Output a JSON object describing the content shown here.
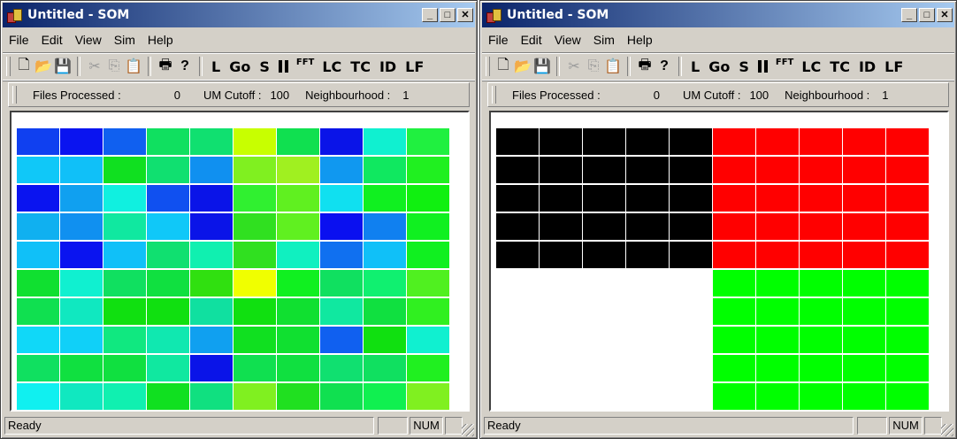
{
  "window": {
    "title": "Untitled - SOM",
    "minimize_glyph": "_",
    "maximize_glyph": "□",
    "close_glyph": "✕"
  },
  "menu": [
    "File",
    "Edit",
    "View",
    "Sim",
    "Help"
  ],
  "toolbar": {
    "icons": [
      "new-file-icon",
      "open-folder-icon",
      "save-disk-icon",
      "cut-icon",
      "copy-icon",
      "paste-icon",
      "print-icon",
      "help-icon"
    ],
    "text_buttons": [
      "L",
      "Go",
      "S",
      "FFT",
      "LC",
      "TC",
      "ID",
      "LF"
    ],
    "icon_glyphs": {
      "new": "🗋",
      "open": "📂",
      "save": "💾",
      "cut": "✂",
      "copy": "⎘",
      "paste": "📋",
      "print": "🖶",
      "help": "?"
    }
  },
  "info": {
    "files_label": "Files Processed :",
    "files_value": "0",
    "cutoff_label": "UM Cutoff :",
    "cutoff_value": "100",
    "neigh_label": "Neighbourhood :",
    "neigh_value": "1"
  },
  "status": {
    "ready": "Ready",
    "num": "NUM"
  },
  "left_map": {
    "rows": 10,
    "cols": 10,
    "colors": [
      [
        "#1040f0",
        "#0a14f0",
        "#1060f0",
        "#10e060",
        "#10e070",
        "#c8ff00",
        "#10e050",
        "#0a14e8",
        "#10f0d0",
        "#20f040"
      ],
      [
        "#10c8f8",
        "#10c0f8",
        "#10e020",
        "#10e070",
        "#1090f0",
        "#80f020",
        "#a0f020",
        "#1098f0",
        "#10e860",
        "#20f020"
      ],
      [
        "#0a14f0",
        "#10a0f0",
        "#10f0e0",
        "#1050f0",
        "#0a14e8",
        "#30f030",
        "#60f020",
        "#10e0f0",
        "#10f020",
        "#10f010"
      ],
      [
        "#10b0f0",
        "#1090f0",
        "#10e8a0",
        "#10c8f8",
        "#0a14e8",
        "#30e020",
        "#60f020",
        "#0a10f0",
        "#1080f0",
        "#10f020"
      ],
      [
        "#10c0f8",
        "#0a14f0",
        "#10c0f8",
        "#10e070",
        "#10f0b0",
        "#30e020",
        "#10f0c0",
        "#1070f0",
        "#10c0f8",
        "#10f020"
      ],
      [
        "#10e030",
        "#10f0d0",
        "#10e060",
        "#10e040",
        "#30e010",
        "#f0ff00",
        "#10f020",
        "#10e060",
        "#10f070",
        "#50f020"
      ],
      [
        "#10e050",
        "#10e8c0",
        "#10e010",
        "#10e010",
        "#10e0a0",
        "#10e010",
        "#10e030",
        "#10e8a0",
        "#10e040",
        "#30f020"
      ],
      [
        "#10d8f8",
        "#10d0f8",
        "#10e880",
        "#10e8b0",
        "#10a0f0",
        "#10e020",
        "#10e030",
        "#1060f0",
        "#10e010",
        "#10f0d0"
      ],
      [
        "#10e060",
        "#10e040",
        "#10e040",
        "#10e8a0",
        "#0a14e8",
        "#10e050",
        "#10e040",
        "#10e070",
        "#10e060",
        "#20f020"
      ],
      [
        "#10f0f0",
        "#10e8c0",
        "#10f0b0",
        "#10e020",
        "#10e080",
        "#80f020",
        "#20e020",
        "#10e050",
        "#10f050",
        "#80f020"
      ]
    ]
  },
  "right_map": {
    "rows": 10,
    "cols": 10,
    "colors": [
      [
        "#000000",
        "#000000",
        "#000000",
        "#000000",
        "#000000",
        "#ff0000",
        "#ff0000",
        "#ff0000",
        "#ff0000",
        "#ff0000"
      ],
      [
        "#000000",
        "#000000",
        "#000000",
        "#000000",
        "#000000",
        "#ff0000",
        "#ff0000",
        "#ff0000",
        "#ff0000",
        "#ff0000"
      ],
      [
        "#000000",
        "#000000",
        "#000000",
        "#000000",
        "#000000",
        "#ff0000",
        "#ff0000",
        "#ff0000",
        "#ff0000",
        "#ff0000"
      ],
      [
        "#000000",
        "#000000",
        "#000000",
        "#000000",
        "#000000",
        "#ff0000",
        "#ff0000",
        "#ff0000",
        "#ff0000",
        "#ff0000"
      ],
      [
        "#000000",
        "#000000",
        "#000000",
        "#000000",
        "#000000",
        "#ff0000",
        "#ff0000",
        "#ff0000",
        "#ff0000",
        "#ff0000"
      ],
      [
        "#ffffff",
        "#ffffff",
        "#ffffff",
        "#ffffff",
        "#ffffff",
        "#00ff00",
        "#00ff00",
        "#00ff00",
        "#00ff00",
        "#00ff00"
      ],
      [
        "#ffffff",
        "#ffffff",
        "#ffffff",
        "#ffffff",
        "#ffffff",
        "#00ff00",
        "#00ff00",
        "#00ff00",
        "#00ff00",
        "#00ff00"
      ],
      [
        "#ffffff",
        "#ffffff",
        "#ffffff",
        "#ffffff",
        "#ffffff",
        "#00ff00",
        "#00ff00",
        "#00ff00",
        "#00ff00",
        "#00ff00"
      ],
      [
        "#ffffff",
        "#ffffff",
        "#ffffff",
        "#ffffff",
        "#ffffff",
        "#00ff00",
        "#00ff00",
        "#00ff00",
        "#00ff00",
        "#00ff00"
      ],
      [
        "#ffffff",
        "#ffffff",
        "#ffffff",
        "#ffffff",
        "#ffffff",
        "#00ff00",
        "#00ff00",
        "#00ff00",
        "#00ff00",
        "#00ff00"
      ]
    ]
  }
}
